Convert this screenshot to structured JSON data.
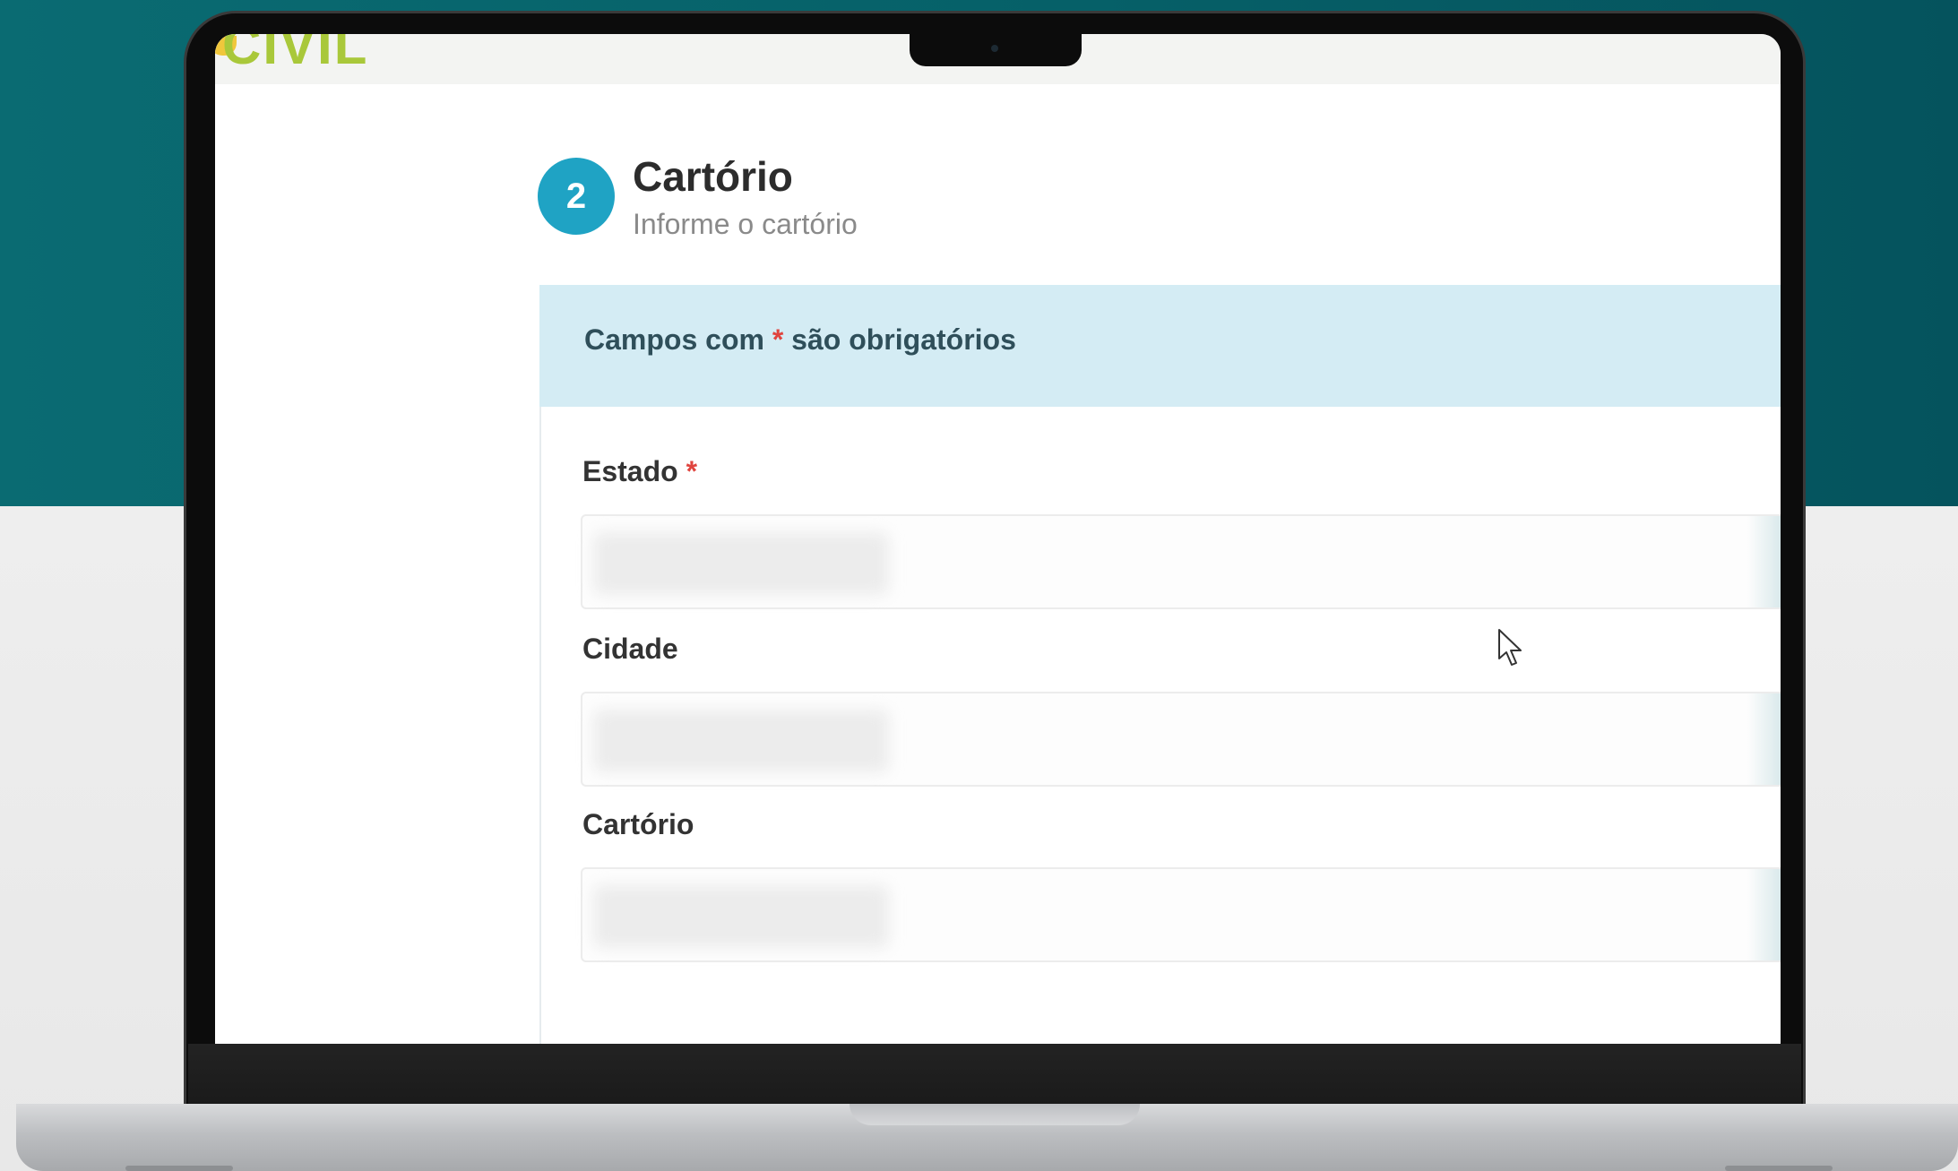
{
  "logo": {
    "text": "CIVIL"
  },
  "step": {
    "number": "2",
    "title": "Cartório",
    "subtitle": "Informe o cartório"
  },
  "notice": {
    "prefix": "Campos com ",
    "asterisk": "*",
    "suffix": " são obrigatórios"
  },
  "fields": {
    "estado": {
      "label": "Estado",
      "required_mark": "*",
      "value": ""
    },
    "cidade": {
      "label": "Cidade",
      "value": ""
    },
    "cartorio": {
      "label": "Cartório",
      "value": ""
    }
  },
  "colors": {
    "step_circle": "#1fa3c4",
    "notice_bg": "#d4ecf4",
    "required": "#e0443e",
    "background_top": "#0a6b72"
  }
}
